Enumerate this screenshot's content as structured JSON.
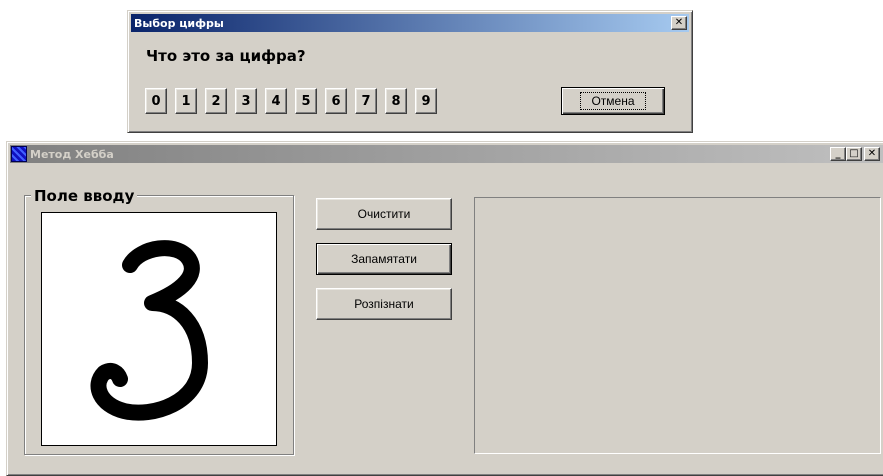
{
  "dialog": {
    "title": "Выбор цифры",
    "close_glyph": "✕",
    "question": "Что это за цифра?",
    "digits": [
      "0",
      "1",
      "2",
      "3",
      "4",
      "5",
      "6",
      "7",
      "8",
      "9"
    ],
    "cancel_label": "Отмена"
  },
  "main": {
    "title": "Метод Хебба",
    "window_controls": {
      "minimize": "_",
      "maximize": "□",
      "close": "✕"
    },
    "group_label": "Поле вводу",
    "buttons": {
      "clear": "Очистити",
      "remember": "Запамятати",
      "recognize": "Розпізнати"
    }
  },
  "colors": {
    "face": "#d4d0c8",
    "active_title": "#0a246a",
    "inactive_title": "#808080"
  }
}
